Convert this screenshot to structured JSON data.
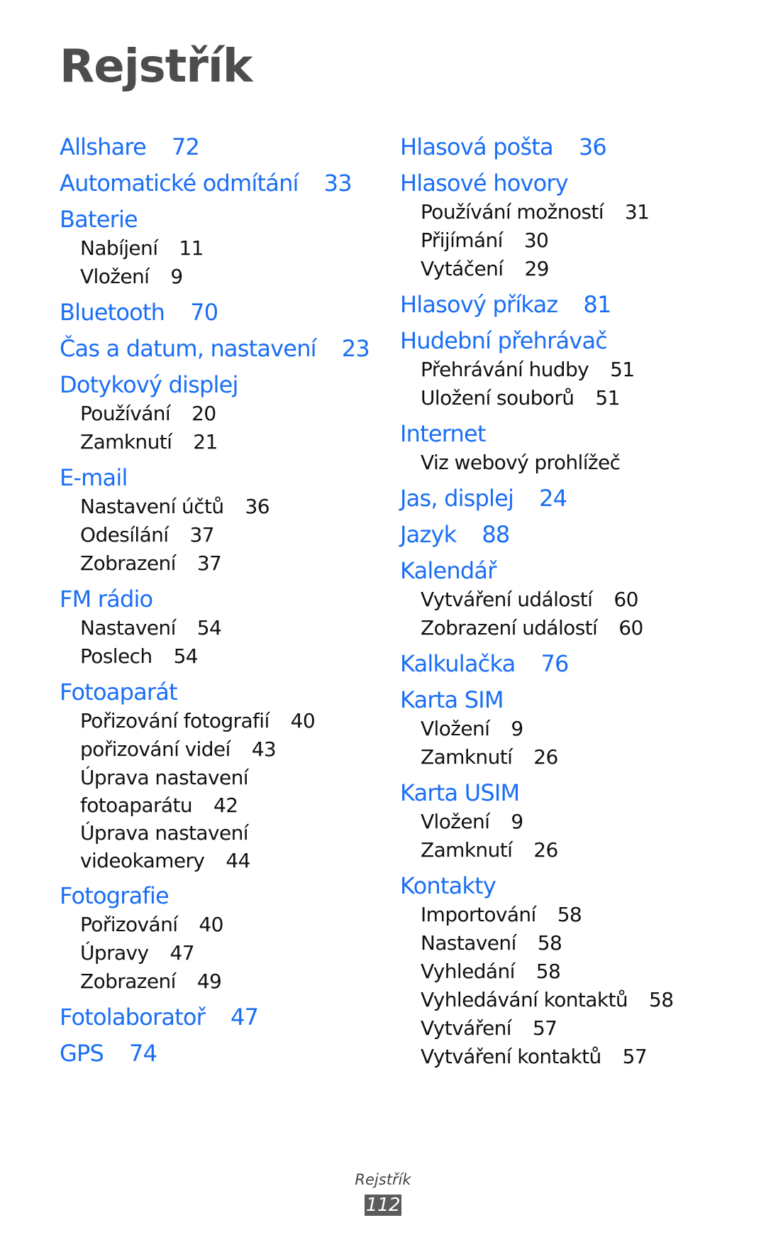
{
  "page": {
    "title": "Rejstřík",
    "footer_title": "Rejstřík",
    "page_number": "112",
    "colors": {
      "heading": "#1a6ef5",
      "subentry": "#111111",
      "title": "#4d4d4d"
    }
  },
  "left_column": [
    {
      "term": "Allshare",
      "page": "72",
      "subs": []
    },
    {
      "term": "Automatické odmítání",
      "page": "33",
      "subs": []
    },
    {
      "term": "Baterie",
      "page": "",
      "subs": [
        {
          "term": "Nabíjení",
          "page": "11"
        },
        {
          "term": "Vložení",
          "page": "9"
        }
      ]
    },
    {
      "term": "Bluetooth",
      "page": "70",
      "subs": []
    },
    {
      "term": "Čas a datum, nastavení",
      "page": "23",
      "subs": []
    },
    {
      "term": "Dotykový displej",
      "page": "",
      "subs": [
        {
          "term": "Používání",
          "page": "20"
        },
        {
          "term": "Zamknutí",
          "page": "21"
        }
      ]
    },
    {
      "term": "E-mail",
      "page": "",
      "subs": [
        {
          "term": "Nastavení účtů",
          "page": "36"
        },
        {
          "term": "Odesílání",
          "page": "37"
        },
        {
          "term": "Zobrazení",
          "page": "37"
        }
      ]
    },
    {
      "term": "FM rádio",
      "page": "",
      "subs": [
        {
          "term": "Nastavení",
          "page": "54"
        },
        {
          "term": "Poslech",
          "page": "54"
        }
      ]
    },
    {
      "term": "Fotoaparát",
      "page": "",
      "subs": [
        {
          "term": "Pořizování fotografií",
          "page": "40"
        },
        {
          "term": "pořizování videí",
          "page": "43"
        },
        {
          "term": "Úprava nastavení",
          "term2": "fotoaparátu",
          "page": "42"
        },
        {
          "term": "Úprava nastavení",
          "term2": "videokamery",
          "page": "44"
        }
      ]
    },
    {
      "term": "Fotografie",
      "page": "",
      "subs": [
        {
          "term": "Pořizování",
          "page": "40"
        },
        {
          "term": "Úpravy",
          "page": "47"
        },
        {
          "term": "Zobrazení",
          "page": "49"
        }
      ]
    },
    {
      "term": "Fotolaboratoř",
      "page": "47",
      "subs": []
    },
    {
      "term": "GPS",
      "page": "74",
      "subs": []
    }
  ],
  "right_column": [
    {
      "term": "Hlasová pošta",
      "page": "36",
      "subs": []
    },
    {
      "term": "Hlasové hovory",
      "page": "",
      "subs": [
        {
          "term": "Používání možností",
          "page": "31"
        },
        {
          "term": "Přijímání",
          "page": "30"
        },
        {
          "term": "Vytáčení",
          "page": "29"
        }
      ]
    },
    {
      "term": "Hlasový příkaz",
      "page": "81",
      "subs": []
    },
    {
      "term": "Hudební přehrávač",
      "page": "",
      "subs": [
        {
          "term": "Přehrávání hudby",
          "page": "51"
        },
        {
          "term": "Uložení souborů",
          "page": "51"
        }
      ]
    },
    {
      "term": "Internet",
      "page": "",
      "subs": [
        {
          "term": "Viz webový prohlížeč",
          "page": ""
        }
      ]
    },
    {
      "term": "Jas, displej",
      "page": "24",
      "subs": []
    },
    {
      "term": "Jazyk",
      "page": "88",
      "subs": []
    },
    {
      "term": "Kalendář",
      "page": "",
      "subs": [
        {
          "term": "Vytváření událostí",
          "page": "60"
        },
        {
          "term": "Zobrazení událostí",
          "page": "60"
        }
      ]
    },
    {
      "term": "Kalkulačka",
      "page": "76",
      "subs": []
    },
    {
      "term": "Karta SIM",
      "page": "",
      "subs": [
        {
          "term": "Vložení",
          "page": "9"
        },
        {
          "term": "Zamknutí",
          "page": "26"
        }
      ]
    },
    {
      "term": "Karta USIM",
      "page": "",
      "subs": [
        {
          "term": "Vložení",
          "page": "9"
        },
        {
          "term": "Zamknutí",
          "page": "26"
        }
      ]
    },
    {
      "term": "Kontakty",
      "page": "",
      "subs": [
        {
          "term": "Importování",
          "page": "58"
        },
        {
          "term": "Nastavení",
          "page": "58"
        },
        {
          "term": "Vyhledání",
          "page": "58"
        },
        {
          "term": "Vyhledávání kontaktů",
          "page": "58"
        },
        {
          "term": "Vytváření",
          "page": "57"
        },
        {
          "term": "Vytváření kontaktů",
          "page": "57"
        }
      ]
    }
  ]
}
